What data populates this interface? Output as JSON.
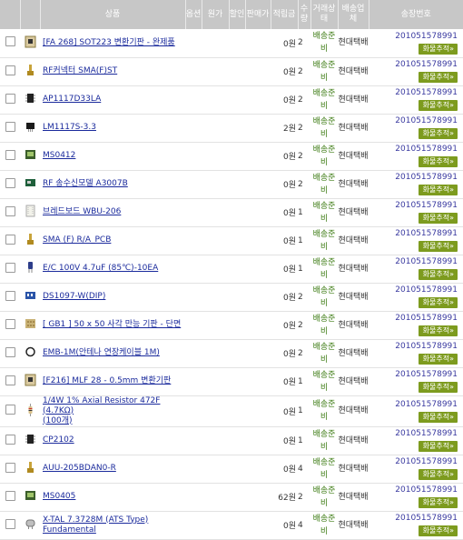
{
  "columns": [
    "상품",
    "옵션",
    "원가",
    "할인",
    "판매가",
    "적립금",
    "수량",
    "거래상태",
    "배송업체",
    "송장번호"
  ],
  "button_label": "화물추적»",
  "rows": [
    {
      "name": "[FA 268] SOT223 변환기판 - 완제품",
      "sub": "",
      "point": "0원",
      "qty": "2",
      "status": "배송준비",
      "courier": "현대택배",
      "tracking": "201051578991",
      "thumb": "board-thumb"
    },
    {
      "name": "RF커넥터 SMA(F)ST",
      "sub": "",
      "point": "0원",
      "qty": "2",
      "status": "배송준비",
      "courier": "현대택배",
      "tracking": "201051578991",
      "thumb": "connector-thumb"
    },
    {
      "name": "AP1117D33LA",
      "sub": "",
      "point": "0원",
      "qty": "2",
      "status": "배송준비",
      "courier": "현대택배",
      "tracking": "201051578991",
      "thumb": "chip-thumb"
    },
    {
      "name": "LM1117S-3.3",
      "sub": "",
      "point": "2원",
      "qty": "2",
      "status": "배송준비",
      "courier": "현대택배",
      "tracking": "201051578991",
      "thumb": "regulator-thumb"
    },
    {
      "name": "MS0412",
      "sub": "",
      "point": "0원",
      "qty": "2",
      "status": "배송준비",
      "courier": "현대택배",
      "tracking": "201051578991",
      "thumb": "lcd-thumb"
    },
    {
      "name": "RF 송수신모델 A3007B",
      "sub": "",
      "point": "0원",
      "qty": "2",
      "status": "배송준비",
      "courier": "현대택배",
      "tracking": "201051578991",
      "thumb": "module-thumb"
    },
    {
      "name": "브레드보드 WBU-206",
      "sub": "",
      "point": "0원",
      "qty": "1",
      "status": "배송준비",
      "courier": "현대택배",
      "tracking": "201051578991",
      "thumb": "breadboard-thumb"
    },
    {
      "name": "SMA (F) R/A_PCB",
      "sub": "",
      "point": "0원",
      "qty": "1",
      "status": "배송준비",
      "courier": "현대택배",
      "tracking": "201051578991",
      "thumb": "connector-thumb"
    },
    {
      "name": "E/C 100V 4.7uF (85℃)-10EA",
      "sub": "",
      "point": "0원",
      "qty": "1",
      "status": "배송준비",
      "courier": "현대택배",
      "tracking": "201051578991",
      "thumb": "capacitor-thumb"
    },
    {
      "name": "DS1097-W(DIP)",
      "sub": "",
      "point": "0원",
      "qty": "2",
      "status": "배송준비",
      "courier": "현대택배",
      "tracking": "201051578991",
      "thumb": "switch-thumb"
    },
    {
      "name": "[ GB1 ] 50 x 50 사각 만능 기판 - 단면",
      "sub": "",
      "point": "0원",
      "qty": "2",
      "status": "배송준비",
      "courier": "현대택배",
      "tracking": "201051578991",
      "thumb": "pcb-thumb"
    },
    {
      "name": "EMB-1M(안테나 연장케이블 1M)",
      "sub": "",
      "point": "0원",
      "qty": "2",
      "status": "배송준비",
      "courier": "현대택배",
      "tracking": "201051578991",
      "thumb": "cable-thumb"
    },
    {
      "name": "[F216] MLF 28 - 0.5mm 변환기판",
      "sub": "",
      "point": "0원",
      "qty": "1",
      "status": "배송준비",
      "courier": "현대택배",
      "tracking": "201051578991",
      "thumb": "board-thumb"
    },
    {
      "name": "1/4W 1% Axial Resistor 472F (4.7KΩ)",
      "sub": "(100개)",
      "point": "0원",
      "qty": "1",
      "status": "배송준비",
      "courier": "현대택배",
      "tracking": "201051578991",
      "thumb": "resistor-thumb"
    },
    {
      "name": "CP2102",
      "sub": "",
      "point": "0원",
      "qty": "1",
      "status": "배송준비",
      "courier": "현대택배",
      "tracking": "201051578991",
      "thumb": "chip-thumb"
    },
    {
      "name": "AUU-205BDAN0-R",
      "sub": "",
      "point": "0원",
      "qty": "4",
      "status": "배송준비",
      "courier": "현대택배",
      "tracking": "201051578991",
      "thumb": "connector-thumb"
    },
    {
      "name": "MS0405",
      "sub": "",
      "point": "62원",
      "qty": "2",
      "status": "배송준비",
      "courier": "현대택배",
      "tracking": "201051578991",
      "thumb": "lcd-thumb"
    },
    {
      "name": "X-TAL 7.3728M (ATS Type)",
      "sub": "Fundamental",
      "point": "0원",
      "qty": "4",
      "status": "배송준비",
      "courier": "현대택배",
      "tracking": "201051578991",
      "thumb": "crystal-thumb"
    }
  ]
}
